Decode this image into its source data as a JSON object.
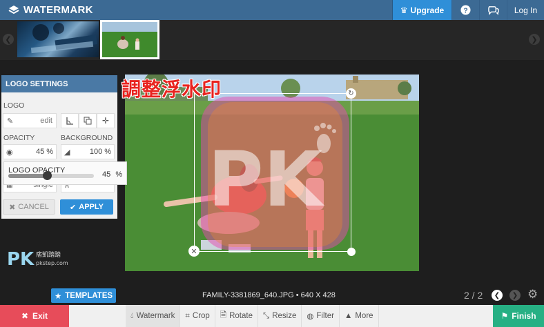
{
  "app": {
    "title": "WATERMARK"
  },
  "topbar": {
    "upgrade_label": "Upgrade",
    "login_label": "Log In"
  },
  "panel": {
    "title": "LOGO SETTINGS",
    "logo_label": "LOGO",
    "edit_label": "edit",
    "opacity_label": "OPACITY",
    "opacity_value": "45",
    "background_label": "BACKGROUND",
    "background_value": "100",
    "percent": "%",
    "tile_value": "single",
    "cancel_label": "CANCEL",
    "apply_label": "APPLY"
  },
  "popup": {
    "label": "LOGO OPACITY",
    "value": "45",
    "percent": "%",
    "level": 0.45
  },
  "image": {
    "overlay_text": "調整浮水印",
    "watermark_text": "PK",
    "filename": "FAMILY-3381869_640.JPG • 640 X 428"
  },
  "bottom": {
    "templates_label": "TEMPLATES",
    "pager": "2 / 2",
    "exit_label": "Exit",
    "finish_label": "Finish",
    "tools": [
      {
        "label": "Watermark"
      },
      {
        "label": "Crop"
      },
      {
        "label": "Rotate"
      },
      {
        "label": "Resize"
      },
      {
        "label": "Filter"
      },
      {
        "label": "More"
      }
    ]
  },
  "corner_mark": {
    "logo": "PK",
    "caption_line1": "痞凱踏踏",
    "caption_line2": "pkstep.com"
  },
  "colors": {
    "topbar": "#3c6a94",
    "accent": "#2f8fd8",
    "exit": "#e74c5a",
    "finish": "#27b084"
  }
}
